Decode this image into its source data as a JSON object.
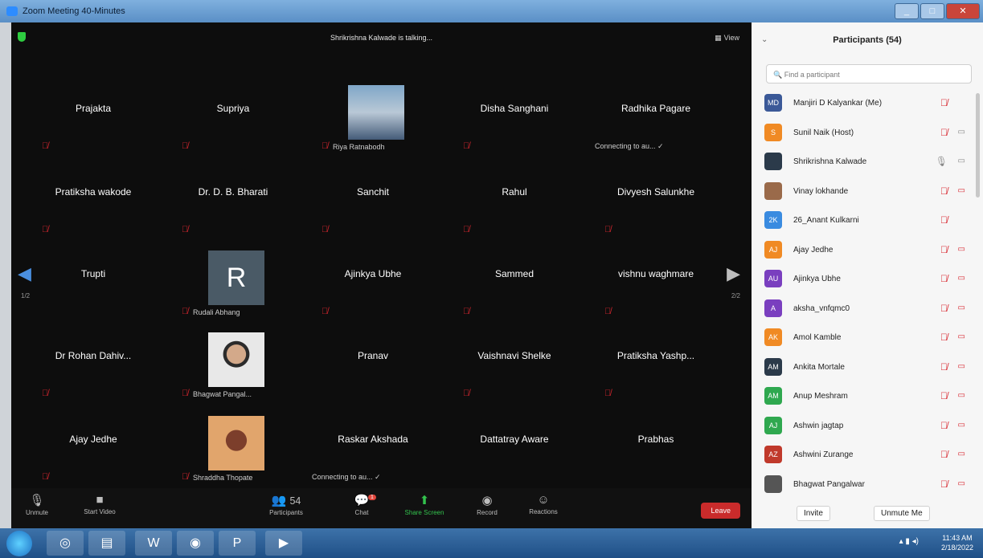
{
  "window": {
    "title": "Zoom Meeting 40-Minutes",
    "min": "_",
    "max": "□",
    "close": "✕"
  },
  "meeting": {
    "talking": "Shrikrishna Kalwade is talking...",
    "view_label": "View",
    "tiles": [
      {
        "name": "Prajakta",
        "muted": true
      },
      {
        "name": "Supriya",
        "muted": true
      },
      {
        "photo": "plane",
        "label": "Riya Ratnabodh",
        "muted": true
      },
      {
        "name": "Disha Sanghani",
        "muted": true
      },
      {
        "name": "Radhika Pagare",
        "connecting": "Connecting to au... ✓"
      },
      {
        "name": "Pratiksha wakode",
        "muted": true
      },
      {
        "name": "Dr. D. B. Bharati",
        "muted": true
      },
      {
        "name": "Sanchit",
        "muted": true
      },
      {
        "name": "Rahul",
        "muted": true
      },
      {
        "name": "Divyesh Salunkhe",
        "muted": true
      },
      {
        "name": "Trupti",
        "muted": false
      },
      {
        "photo": "r",
        "letter": "R",
        "label": "Rudali Abhang",
        "muted": true
      },
      {
        "name": "Ajinkya Ubhe",
        "muted": true
      },
      {
        "name": "Sammed",
        "muted": true
      },
      {
        "name": "vishnu waghmare",
        "muted": true
      },
      {
        "name": "Dr Rohan Dahiv...",
        "muted": true
      },
      {
        "photo": "man",
        "label": "Bhagwat Pangal...",
        "muted": true
      },
      {
        "name": "Pranav",
        "muted": false
      },
      {
        "name": "Vaishnavi Shelke",
        "muted": true
      },
      {
        "name": "Pratiksha Yashp...",
        "muted": true
      },
      {
        "name": "Ajay Jedhe",
        "muted": true
      },
      {
        "photo": "woman",
        "label": "Shraddha Thopate",
        "muted": true
      },
      {
        "name": "Raskar Akshada",
        "connecting": "Connecting to au... ✓"
      },
      {
        "name": "Dattatray Aware",
        "muted": false
      },
      {
        "name": "Prabhas",
        "muted": false
      }
    ],
    "page_left": "1/2",
    "page_right": "2/2"
  },
  "toolbar": {
    "unmute": "Unmute",
    "start_video": "Start Video",
    "participants": "Participants",
    "participants_count": "54",
    "chat": "Chat",
    "chat_badge": "1",
    "share_screen": "Share Screen",
    "record": "Record",
    "reactions": "Reactions",
    "leave": "Leave"
  },
  "panel": {
    "title": "Participants (54)",
    "search_placeholder": "Find a participant",
    "participants": [
      {
        "initials": "MD",
        "color": "#3b5998",
        "name": "Manjiri D Kalyankar (Me)",
        "mic_muted": true,
        "video_off": false,
        "video_icon": false
      },
      {
        "initials": "S",
        "color": "#f08a24",
        "name": "Sunil Naik (Host)",
        "mic_muted": true,
        "video_icon": true,
        "video_off": false
      },
      {
        "initials": "",
        "color": "#2b3a4a",
        "name": "Shrikrishna Kalwade",
        "mic_muted": false,
        "video_icon": true,
        "video_off": false
      },
      {
        "initials": "",
        "color": "#9a6a4a",
        "name": "Vinay lokhande",
        "mic_muted": true,
        "video_icon": true,
        "video_off": true
      },
      {
        "initials": "2K",
        "color": "#3a8be0",
        "name": "26_Anant Kulkarni",
        "mic_muted": true,
        "video_icon": false,
        "video_off": false
      },
      {
        "initials": "AJ",
        "color": "#f08a24",
        "name": "Ajay Jedhe",
        "mic_muted": true,
        "video_icon": true,
        "video_off": true
      },
      {
        "initials": "AU",
        "color": "#7a3fbf",
        "name": "Ajinkya Ubhe",
        "mic_muted": true,
        "video_icon": true,
        "video_off": true
      },
      {
        "initials": "A",
        "color": "#7a3fbf",
        "name": "aksha_vnfqmc0",
        "mic_muted": true,
        "video_icon": true,
        "video_off": true
      },
      {
        "initials": "AK",
        "color": "#f08a24",
        "name": "Amol Kamble",
        "mic_muted": true,
        "video_icon": true,
        "video_off": true
      },
      {
        "initials": "AM",
        "color": "#2b3a4a",
        "name": "Ankita Mortale",
        "mic_muted": true,
        "video_icon": true,
        "video_off": true
      },
      {
        "initials": "AM",
        "color": "#2fa84f",
        "name": "Anup Meshram",
        "mic_muted": true,
        "video_icon": true,
        "video_off": true
      },
      {
        "initials": "AJ",
        "color": "#2fa84f",
        "name": "Ashwin jagtap",
        "mic_muted": true,
        "video_icon": true,
        "video_off": true
      },
      {
        "initials": "AZ",
        "color": "#c0392b",
        "name": "Ashwini Zurange",
        "mic_muted": true,
        "video_icon": true,
        "video_off": true
      },
      {
        "initials": "",
        "color": "#555",
        "name": "Bhagwat Pangalwar",
        "mic_muted": true,
        "video_icon": true,
        "video_off": true
      }
    ],
    "invite": "Invite",
    "unmute_me": "Unmute Me"
  },
  "taskbar": {
    "time": "11:43 AM",
    "date": "2/18/2022"
  }
}
